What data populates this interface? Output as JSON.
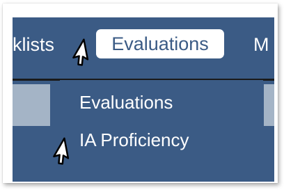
{
  "top_menu": {
    "items": [
      {
        "label": "klists"
      },
      {
        "label": "Evaluations",
        "active": true
      },
      {
        "label": "M"
      }
    ]
  },
  "dropdown": {
    "items": [
      {
        "label": "Evaluations"
      },
      {
        "label": "IA Proficiency"
      }
    ]
  },
  "colors": {
    "menu_bar_bg": "#3b5b85",
    "active_tab_bg": "#ffffff",
    "side_panel_bg": "#a4b4c6",
    "text": "#ffffff"
  },
  "icons": [
    "mouse-pointer-icon",
    "mouse-pointer-icon"
  ]
}
